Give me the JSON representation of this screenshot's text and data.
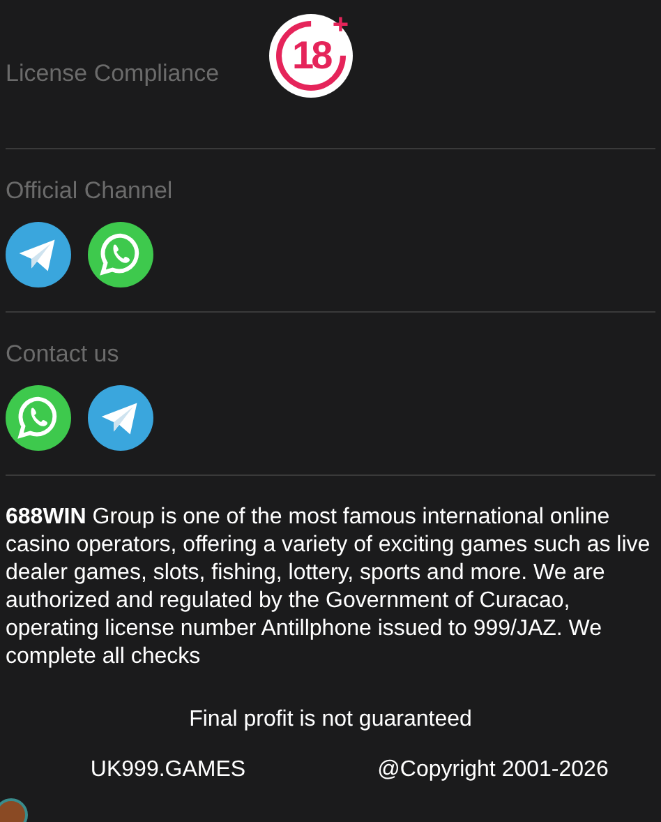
{
  "sections": [
    {
      "kind": "license",
      "title": "License Compliance",
      "badge": {
        "number": "18",
        "sign": "+"
      }
    },
    {
      "kind": "channels",
      "title": "Official Channel",
      "icons": [
        {
          "kind": "telegram"
        },
        {
          "kind": "whatsapp"
        }
      ]
    },
    {
      "kind": "channels",
      "title": "Contact us",
      "icons": [
        {
          "kind": "whatsapp"
        },
        {
          "kind": "telegram"
        }
      ]
    }
  ],
  "about": "**688WIN** Group is one of the most famous international online casino operators, offering a variety of exciting games such as live dealer games, slots, fishing, lottery, sports and more. We are authorized and regulated by the Government of Curacao, operating license number Antillphone issued to 999/JAZ. We complete all checks",
  "notice": "Final profit is not guaranteed",
  "footer": {
    "site": "UK999.GAMES",
    "copyright": "@Copyright 2001-2026"
  }
}
